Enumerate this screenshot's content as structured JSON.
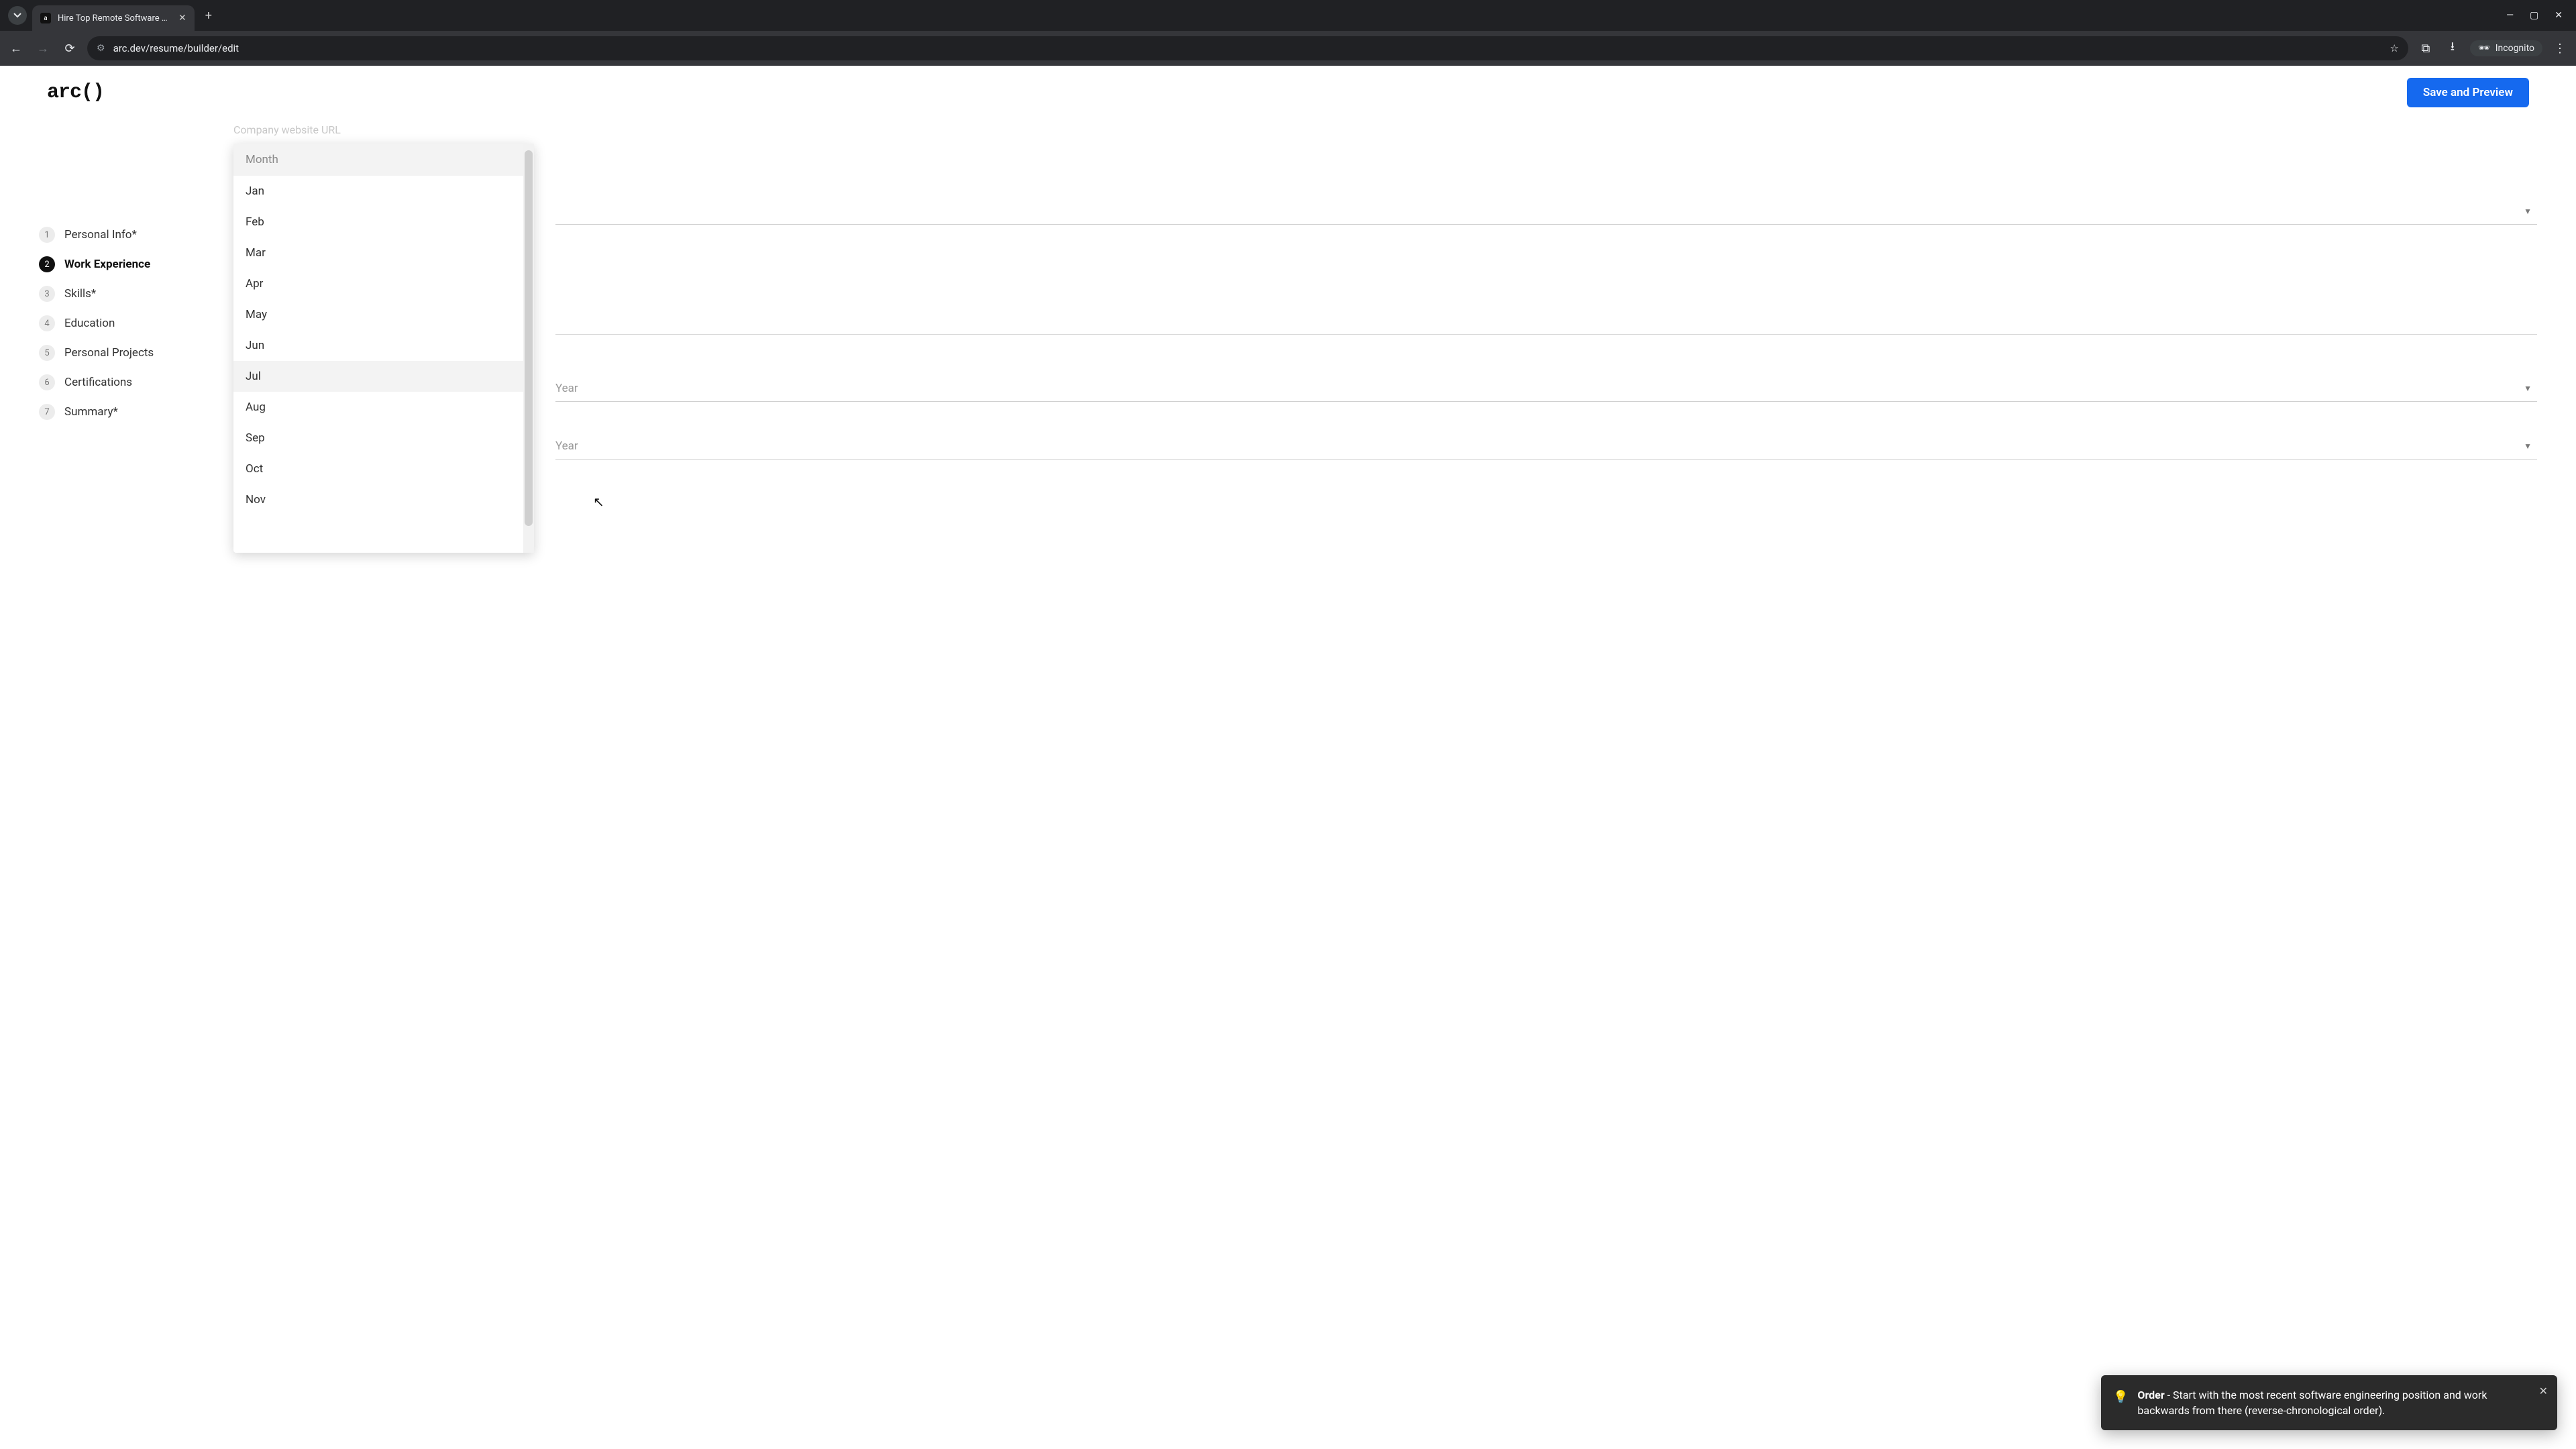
{
  "browser": {
    "tab_title": "Hire Top Remote Software Dev",
    "url": "arc.dev/resume/builder/edit",
    "incognito_label": "Incognito"
  },
  "header": {
    "logo_text": "arc()",
    "save_label": "Save and Preview"
  },
  "steps": [
    {
      "num": "1",
      "label": "Personal Info*"
    },
    {
      "num": "2",
      "label": "Work Experience"
    },
    {
      "num": "3",
      "label": "Skills*"
    },
    {
      "num": "4",
      "label": "Education"
    },
    {
      "num": "5",
      "label": "Personal Projects"
    },
    {
      "num": "6",
      "label": "Certifications"
    },
    {
      "num": "7",
      "label": "Summary*"
    }
  ],
  "form": {
    "company_url_label": "Company website URL",
    "year_placeholder_1": "Year",
    "year_placeholder_2": "Year"
  },
  "dropdown": {
    "header": "Month",
    "items": [
      "Jan",
      "Feb",
      "Mar",
      "Apr",
      "May",
      "Jun",
      "Jul",
      "Aug",
      "Sep",
      "Oct",
      "Nov"
    ],
    "hover_index": 6
  },
  "toast": {
    "title": "Order",
    "body": " - Start with the most recent software engineering position and work backwards from there (reverse-chronological order)."
  }
}
